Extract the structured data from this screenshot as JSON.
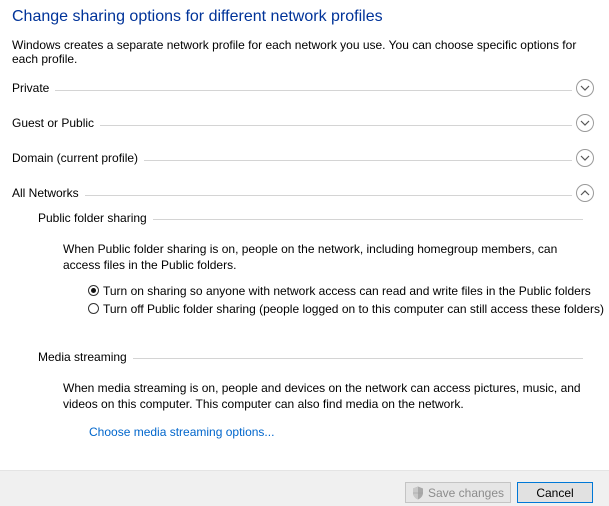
{
  "header": {
    "title": "Change sharing options for different network profiles",
    "description": "Windows creates a separate network profile for each network you use. You can choose specific options for each profile."
  },
  "profiles": [
    {
      "label": "Private",
      "state": "collapsed"
    },
    {
      "label": "Guest or Public",
      "state": "collapsed"
    },
    {
      "label": "Domain (current profile)",
      "state": "collapsed"
    },
    {
      "label": "All Networks",
      "state": "expanded"
    }
  ],
  "all_networks": {
    "public_folder_sharing": {
      "heading": "Public folder sharing",
      "description": "When Public folder sharing is on, people on the network, including homegroup members, can access files in the Public folders.",
      "options": [
        {
          "label": "Turn on sharing so anyone with network access can read and write files in the Public folders",
          "selected": true
        },
        {
          "label": "Turn off Public folder sharing (people logged on to this computer can still access these folders)",
          "selected": false
        }
      ]
    },
    "media_streaming": {
      "heading": "Media streaming",
      "description": "When media streaming is on, people and devices on the network can access pictures, music, and videos on this computer. This computer can also find media on the network.",
      "link": "Choose media streaming options..."
    }
  },
  "footer": {
    "save_label": "Save changes",
    "save_enabled": false,
    "cancel_label": "Cancel"
  },
  "colors": {
    "title": "#003399",
    "link": "#0066cc",
    "footer_bg": "#f0f0f0",
    "divider": "#d4d4d4"
  },
  "icons": {
    "collapsed": "chevron-down-icon",
    "expanded": "chevron-up-icon",
    "save": "uac-shield-icon"
  }
}
